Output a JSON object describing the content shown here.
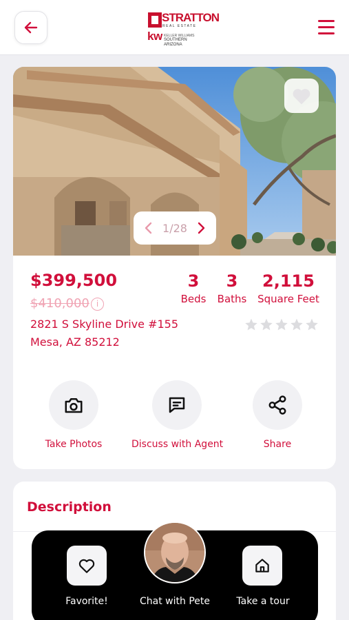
{
  "header": {
    "brand_name": "STRATTON",
    "brand_tagline": "REAL ESTATE",
    "partner_mark": "kw",
    "partner_line1": "KELLER WILLIAMS",
    "partner_line2": "SOUTHERN ARIZONA"
  },
  "listing": {
    "photo_index": "1/28",
    "price": "$399,500",
    "original_price": "$410,000",
    "address_line1": "2821 S Skyline Drive #155",
    "address_line2": "Mesa, AZ 85212",
    "stats": [
      {
        "value": "3",
        "label": "Beds"
      },
      {
        "value": "3",
        "label": "Baths"
      },
      {
        "value": "2,115",
        "label": "Square Feet"
      }
    ],
    "rating": 0,
    "rating_max": 5
  },
  "actions": [
    {
      "label": "Take Photos",
      "icon": "camera-icon"
    },
    {
      "label": "Discuss with Agent",
      "icon": "message-icon"
    },
    {
      "label": "Share",
      "icon": "share-icon"
    }
  ],
  "description": {
    "title": "Description"
  },
  "bottom_bar": {
    "favorite_label": "Favorite!",
    "chat_label": "Chat with Pete",
    "tour_label": "Take a tour"
  },
  "colors": {
    "accent": "#d10f3b",
    "background": "#efeff3",
    "card": "#ffffff",
    "bar": "#000000"
  }
}
